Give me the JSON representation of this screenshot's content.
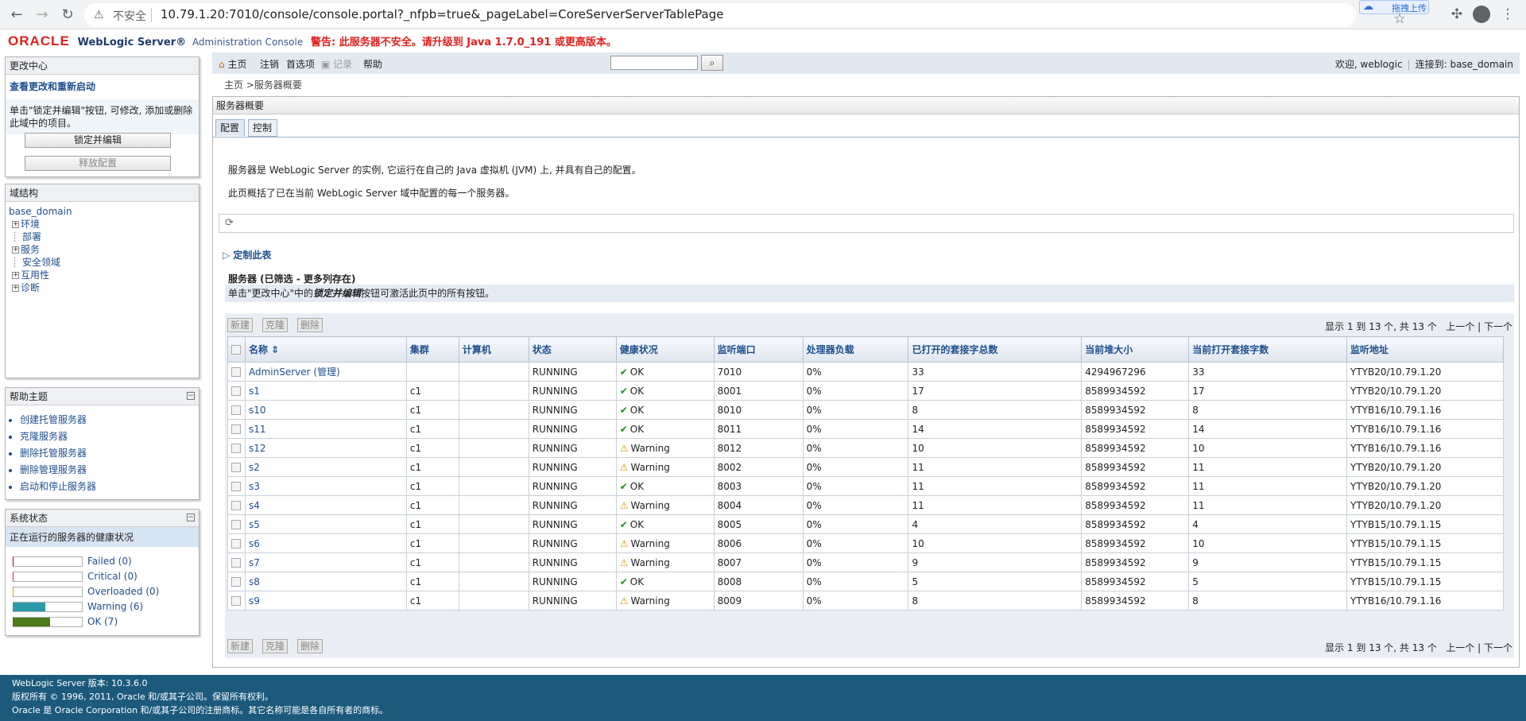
{
  "browser": {
    "url": "10.79.1.20:7010/console/console.portal?_nfpb=true&_pageLabel=CoreServerServerTablePage",
    "insecure_label": "不安全",
    "upload_label": "拖拽上传"
  },
  "header": {
    "oracle": "ORACLE",
    "product": "WebLogic Server®",
    "console": "Administration Console",
    "warning": "警告: 此服务器不安全。请升级到 Java 1.7.0_191 或更高版本。"
  },
  "change_center": {
    "title": "更改中心",
    "link": "查看更改和重新启动",
    "text": "单击\"锁定并编辑\"按钮, 可修改, 添加或删除此域中的项目。",
    "lock_button": "锁定并编辑",
    "release_button": "释放配置"
  },
  "domain_structure": {
    "title": "域结构",
    "root": "base_domain",
    "nodes": [
      {
        "label": "环境",
        "expandable": true
      },
      {
        "label": "部署",
        "expandable": false
      },
      {
        "label": "服务",
        "expandable": true
      },
      {
        "label": "安全领域",
        "expandable": false
      },
      {
        "label": "互用性",
        "expandable": true
      },
      {
        "label": "诊断",
        "expandable": true
      }
    ]
  },
  "help_topics": {
    "title": "帮助主题",
    "items": [
      "创建托管服务器",
      "克隆服务器",
      "删除托管服务器",
      "删除管理服务器",
      "启动和停止服务器"
    ]
  },
  "system_status": {
    "title": "系统状态",
    "subtitle": "正在运行的服务器的健康状况",
    "rows": [
      {
        "label": "Failed (0)",
        "fraction": 0.0,
        "color": "#c00000"
      },
      {
        "label": "Critical (0)",
        "fraction": 0.0,
        "color": "#e03030"
      },
      {
        "label": "Overloaded (0)",
        "fraction": 0.0,
        "color": "#e0a000"
      },
      {
        "label": "Warning (6)",
        "fraction": 0.46,
        "color": "#2a9aaa"
      },
      {
        "label": "OK (7)",
        "fraction": 0.54,
        "color": "#4a7a1a"
      }
    ]
  },
  "topbar": {
    "home": "主页",
    "logout": "注销",
    "prefs": "首选项",
    "record": "记录",
    "help": "帮助",
    "welcome": "欢迎, weblogic",
    "connected": "连接到: base_domain"
  },
  "breadcrumb": "主页 >服务器概要",
  "page": {
    "title": "服务器概要",
    "tab_config": "配置",
    "tab_control": "控制",
    "desc1": "服务器是 WebLogic Server 的实例, 它运行在自己的 Java 虚拟机 (JVM) 上, 并具有自己的配置。",
    "desc2": "此页概括了已在当前 WebLogic Server 域中配置的每一个服务器。",
    "customize": "定制此表",
    "table_title": "服务器 (已筛选 - 更多列存在)",
    "hint_pre": "单击\"更改中心\"中的",
    "hint_em": "锁定并编辑",
    "hint_post": "按钮可激活此页中的所有按钮。",
    "btn_new": "新建",
    "btn_clone": "克隆",
    "btn_delete": "删除",
    "pager_text": "显示 1 到 13 个, 共 13 个",
    "prev": "上一个",
    "next": "下一个"
  },
  "table": {
    "columns": [
      "名称",
      "集群",
      "计算机",
      "状态",
      "健康状况",
      "监听端口",
      "处理器负载",
      "已打开的套接字总数",
      "当前堆大小",
      "当前打开套接字数",
      "监听地址"
    ],
    "rows": [
      [
        "AdminServer (管理)",
        "",
        "",
        "RUNNING",
        "OK",
        "7010",
        "0%",
        "33",
        "4294967296",
        "33",
        "YTYB20/10.79.1.20"
      ],
      [
        "s1",
        "c1",
        "",
        "RUNNING",
        "OK",
        "8001",
        "0%",
        "17",
        "8589934592",
        "17",
        "YTYB20/10.79.1.20"
      ],
      [
        "s10",
        "c1",
        "",
        "RUNNING",
        "OK",
        "8010",
        "0%",
        "8",
        "8589934592",
        "8",
        "YTYB16/10.79.1.16"
      ],
      [
        "s11",
        "c1",
        "",
        "RUNNING",
        "OK",
        "8011",
        "0%",
        "14",
        "8589934592",
        "14",
        "YTYB16/10.79.1.16"
      ],
      [
        "s12",
        "c1",
        "",
        "RUNNING",
        "Warning",
        "8012",
        "0%",
        "10",
        "8589934592",
        "10",
        "YTYB16/10.79.1.16"
      ],
      [
        "s2",
        "c1",
        "",
        "RUNNING",
        "Warning",
        "8002",
        "0%",
        "11",
        "8589934592",
        "11",
        "YTYB20/10.79.1.20"
      ],
      [
        "s3",
        "c1",
        "",
        "RUNNING",
        "OK",
        "8003",
        "0%",
        "11",
        "8589934592",
        "11",
        "YTYB20/10.79.1.20"
      ],
      [
        "s4",
        "c1",
        "",
        "RUNNING",
        "Warning",
        "8004",
        "0%",
        "11",
        "8589934592",
        "11",
        "YTYB20/10.79.1.20"
      ],
      [
        "s5",
        "c1",
        "",
        "RUNNING",
        "OK",
        "8005",
        "0%",
        "4",
        "8589934592",
        "4",
        "YTYB15/10.79.1.15"
      ],
      [
        "s6",
        "c1",
        "",
        "RUNNING",
        "Warning",
        "8006",
        "0%",
        "10",
        "8589934592",
        "10",
        "YTYB15/10.79.1.15"
      ],
      [
        "s7",
        "c1",
        "",
        "RUNNING",
        "Warning",
        "8007",
        "0%",
        "9",
        "8589934592",
        "9",
        "YTYB15/10.79.1.15"
      ],
      [
        "s8",
        "c1",
        "",
        "RUNNING",
        "OK",
        "8008",
        "0%",
        "5",
        "8589934592",
        "5",
        "YTYB15/10.79.1.15"
      ],
      [
        "s9",
        "c1",
        "",
        "RUNNING",
        "Warning",
        "8009",
        "0%",
        "8",
        "8589934592",
        "8",
        "YTYB16/10.79.1.16"
      ]
    ]
  },
  "footer": {
    "line1": "WebLogic Server 版本: 10.3.6.0",
    "line2": "版权所有 © 1996, 2011, Oracle 和/或其子公司。保留所有权利。",
    "line3": "Oracle 是 Oracle Corporation 和/或其子公司的注册商标。其它名称可能是各自所有者的商标。"
  }
}
